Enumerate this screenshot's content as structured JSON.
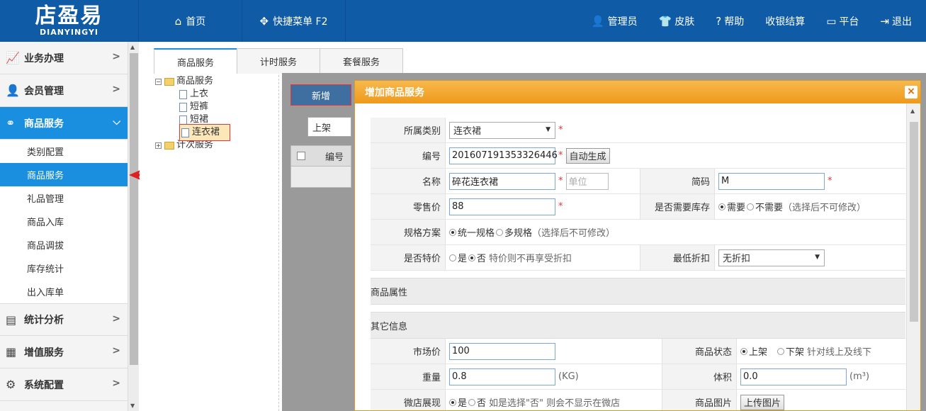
{
  "header": {
    "logo_cn": "店盈易",
    "logo_en": "DIANYINGYI",
    "home": "首页",
    "quick_menu": "快捷菜单 F2",
    "admin": "管理员",
    "skin": "皮肤",
    "help": "帮助",
    "checkout": "收银结算",
    "platform": "平台",
    "logout": "退出"
  },
  "sidebar": {
    "groups": [
      {
        "label": "业务办理"
      },
      {
        "label": "会员管理"
      },
      {
        "label": "商品服务"
      },
      {
        "label": "统计分析"
      },
      {
        "label": "增值服务"
      },
      {
        "label": "系统配置"
      }
    ],
    "sub_items": [
      "类别配置",
      "商品服务",
      "礼品管理",
      "商品入库",
      "商品调拔",
      "库存统计",
      "出入库单"
    ]
  },
  "tabs": [
    "商品服务",
    "计时服务",
    "套餐服务"
  ],
  "tree": {
    "root": "商品服务",
    "children": [
      "上衣",
      "短裤",
      "短裙",
      "连衣裙"
    ],
    "second": "计次服务"
  },
  "toolbar": {
    "new": "新增",
    "shelf_filter": "上架",
    "col_number": "编号"
  },
  "dialog": {
    "title": "增加商品服务",
    "close": "×",
    "category_label": "所属类别",
    "category_value": "连衣裙",
    "code_label": "编号",
    "code_value": "201607191353326446",
    "auto_gen": "自动生成",
    "name_label": "名称",
    "name_value": "碎花连衣裙",
    "unit_placeholder": "单位",
    "short_label": "简码",
    "short_value": "M",
    "price_label": "零售价",
    "price_value": "88",
    "stock_label": "是否需要库存",
    "stock_need": "需要",
    "stock_noneed": "不需要",
    "stock_note": "（选择后不可修改）",
    "spec_label": "规格方案",
    "spec_single": "统一规格",
    "spec_multi": "多规格",
    "spec_note": "（选择后不可修改）",
    "special_label": "是否特价",
    "yes": "是",
    "no": "否",
    "special_note": "特价则不再享受折扣",
    "min_discount_label": "最低折扣",
    "min_discount_value": "无折扣",
    "attr_section": "商品属性",
    "other_section": "其它信息",
    "market_label": "市场价",
    "market_value": "100",
    "status_label": "商品状态",
    "status_on": "上架",
    "status_off": "下架",
    "status_note": "针对线上及线下",
    "weight_label": "重量",
    "weight_value": "0.8",
    "weight_unit": "(KG)",
    "volume_label": "体积",
    "volume_value": "0.0",
    "volume_unit": "(m³)",
    "wd_label": "微店展现",
    "wd_note": "如是选择\"否\" 则会不显示在微店",
    "img_label": "商品图片",
    "upload": "上传图片"
  }
}
